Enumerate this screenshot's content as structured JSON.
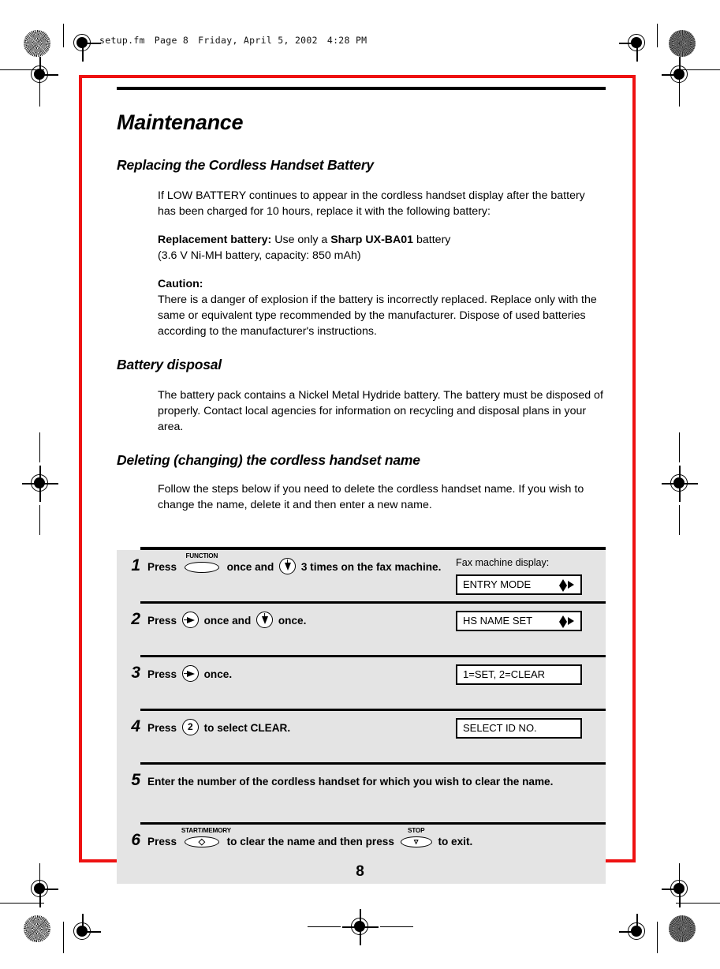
{
  "slug": {
    "filename": "setup.fm",
    "page": "Page 8",
    "date": "Friday, April 5, 2002",
    "time": "4:28 PM",
    "full": "setup.fm  Page 8  Friday,  April 5, 2002  4:28 PM"
  },
  "chapter_title": "Maintenance",
  "sections": [
    {
      "heading": "Replacing the Cordless Handset Battery",
      "paragraphs": [
        "If LOW BATTERY continues to appear in the cordless handset display after the battery has been charged for 10 hours, replace it with the following battery:"
      ],
      "replacement_label": "Replacement battery:",
      "replacement_text_1": " Use only a ",
      "replacement_brand": "Sharp UX-BA01",
      "replacement_text_2": " battery",
      "replacement_line2": "(3.6 V Ni-MH battery, capacity: 850 mAh)",
      "caution_label": "Caution:",
      "caution_text": "There is a danger of explosion if the battery is incorrectly replaced. Replace only with the same or equivalent type recommended by the manufacturer. Dispose of used batteries according to the manufacturer's instructions."
    },
    {
      "heading": "Battery disposal",
      "paragraphs": [
        "The battery pack contains a Nickel Metal Hydride battery. The battery must be disposed of properly. Contact local agencies for information on recycling and disposal plans in your area."
      ]
    },
    {
      "heading": "Deleting (changing) the cordless handset name",
      "paragraphs": [
        "Follow the steps below if you need to delete the cordless handset name. If you wish to change the name, delete it and then enter a new name."
      ]
    }
  ],
  "display_column_label": "Fax machine display:",
  "steps": [
    {
      "number": "1",
      "text_before": "Press",
      "button_caption": "FUNCTION",
      "text_mid": "once and",
      "text_after": "3 times on the fax machine.",
      "display": "ENTRY MODE",
      "display_arrows": true
    },
    {
      "number": "2",
      "text_before": "Press",
      "text_mid": "once and",
      "text_after": "once.",
      "display": "HS NAME SET",
      "display_arrows": true
    },
    {
      "number": "3",
      "text_before": "Press",
      "text_after": "once.",
      "display": "1=SET, 2=CLEAR",
      "display_arrows": false
    },
    {
      "number": "4",
      "text_before": "Press",
      "key_digit": "2",
      "text_after": "to select CLEAR.",
      "display": "SELECT ID NO.",
      "display_arrows": false
    },
    {
      "number": "5",
      "text_full": "Enter the number of the cordless handset for which you wish to clear the name.",
      "display": "",
      "display_arrows": false
    },
    {
      "number": "6",
      "text_before": "Press",
      "button_caption_start": "START/MEMORY",
      "text_mid": "to clear the name and then press",
      "button_caption_stop": "STOP",
      "text_after": "to exit.",
      "display": "",
      "display_arrows": false
    }
  ],
  "page_number": "8",
  "colors": {
    "frame_red": "#ee1111",
    "table_background": "#e4e4e4",
    "rule_black": "#000000"
  }
}
